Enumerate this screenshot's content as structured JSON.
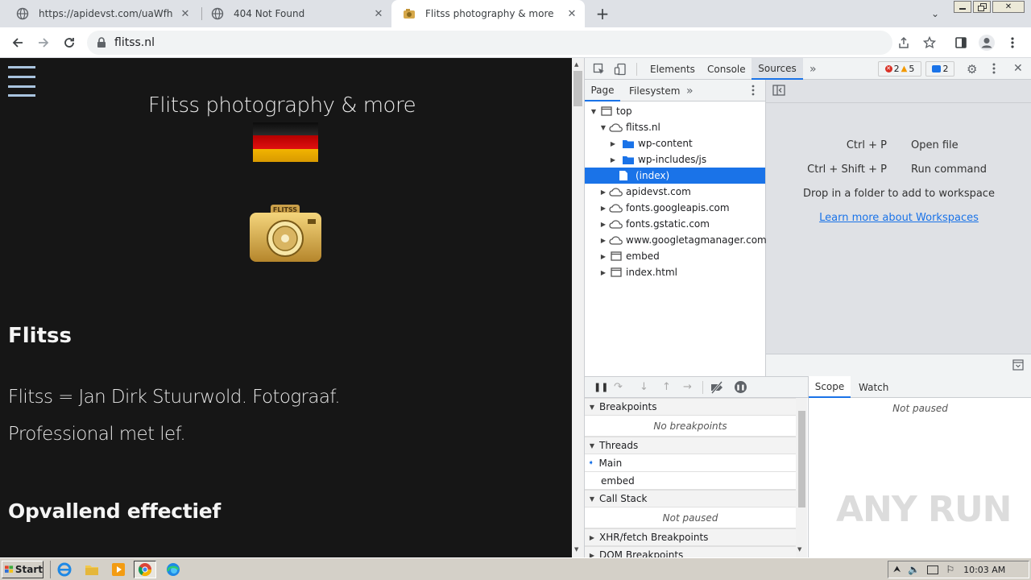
{
  "browser": {
    "tabs": [
      {
        "title": "https://apidevst.com/uaWfhCZHOIP",
        "active": false
      },
      {
        "title": "404 Not Found",
        "active": false
      },
      {
        "title": "Flitss photography & more",
        "active": true
      }
    ],
    "new_tab": "+",
    "address": "flitss.nl"
  },
  "page": {
    "site_title": "Flitss photography & more",
    "logo_text": "FLITSS",
    "heading1": "Flitss",
    "paragraph_line1": "Flitss = Jan Dirk Stuurwold. Fotograaf.",
    "paragraph_line2": "Professional met lef.",
    "heading2": "Opvallend effectief"
  },
  "devtools": {
    "tabs": [
      "Elements",
      "Console",
      "Sources"
    ],
    "active_tab": "Sources",
    "more": "»",
    "errors": "2",
    "warnings": "5",
    "messages": "2",
    "nav_tabs": [
      "Page",
      "Filesystem"
    ],
    "tree": [
      {
        "label": "top",
        "type": "frame",
        "depth": 0,
        "expanded": true
      },
      {
        "label": "flitss.nl",
        "type": "cloud",
        "depth": 1,
        "expanded": true
      },
      {
        "label": "wp-content",
        "type": "folder",
        "depth": 2,
        "expanded": false
      },
      {
        "label": "wp-includes/js",
        "type": "folder",
        "depth": 2,
        "expanded": false
      },
      {
        "label": "(index)",
        "type": "file",
        "depth": 2,
        "selected": true
      },
      {
        "label": "apidevst.com",
        "type": "cloud",
        "depth": 1,
        "expanded": false
      },
      {
        "label": "fonts.googleapis.com",
        "type": "cloud",
        "depth": 1,
        "expanded": false
      },
      {
        "label": "fonts.gstatic.com",
        "type": "cloud",
        "depth": 1,
        "expanded": false
      },
      {
        "label": "www.googletagmanager.com",
        "type": "cloud",
        "depth": 1,
        "expanded": false
      },
      {
        "label": "embed",
        "type": "frame",
        "depth": 1,
        "expanded": false
      },
      {
        "label": "index.html",
        "type": "frame",
        "depth": 1,
        "expanded": false
      }
    ],
    "shortcuts": [
      {
        "keys": "Ctrl + P",
        "action": "Open file"
      },
      {
        "keys": "Ctrl + Shift + P",
        "action": "Run command"
      }
    ],
    "drop_text": "Drop in a folder to add to workspace",
    "learn_more": "Learn more about Workspaces",
    "debugger": {
      "breakpoints_title": "Breakpoints",
      "breakpoints_empty": "No breakpoints",
      "threads_title": "Threads",
      "threads": [
        "Main",
        "embed"
      ],
      "callstack_title": "Call Stack",
      "callstack_status": "Not paused",
      "xhr_title": "XHR/fetch Breakpoints",
      "dom_title": "DOM Breakpoints"
    },
    "scope_tabs": [
      "Scope",
      "Watch"
    ],
    "scope_status": "Not paused"
  },
  "taskbar": {
    "start": "Start",
    "clock": "10:03 AM"
  },
  "watermark": "ANY RUN",
  "colors": {
    "page_bg": "#161616",
    "selection": "#1a73e8",
    "link": "#1a73e8",
    "taskbar": "#d4d0c8"
  }
}
